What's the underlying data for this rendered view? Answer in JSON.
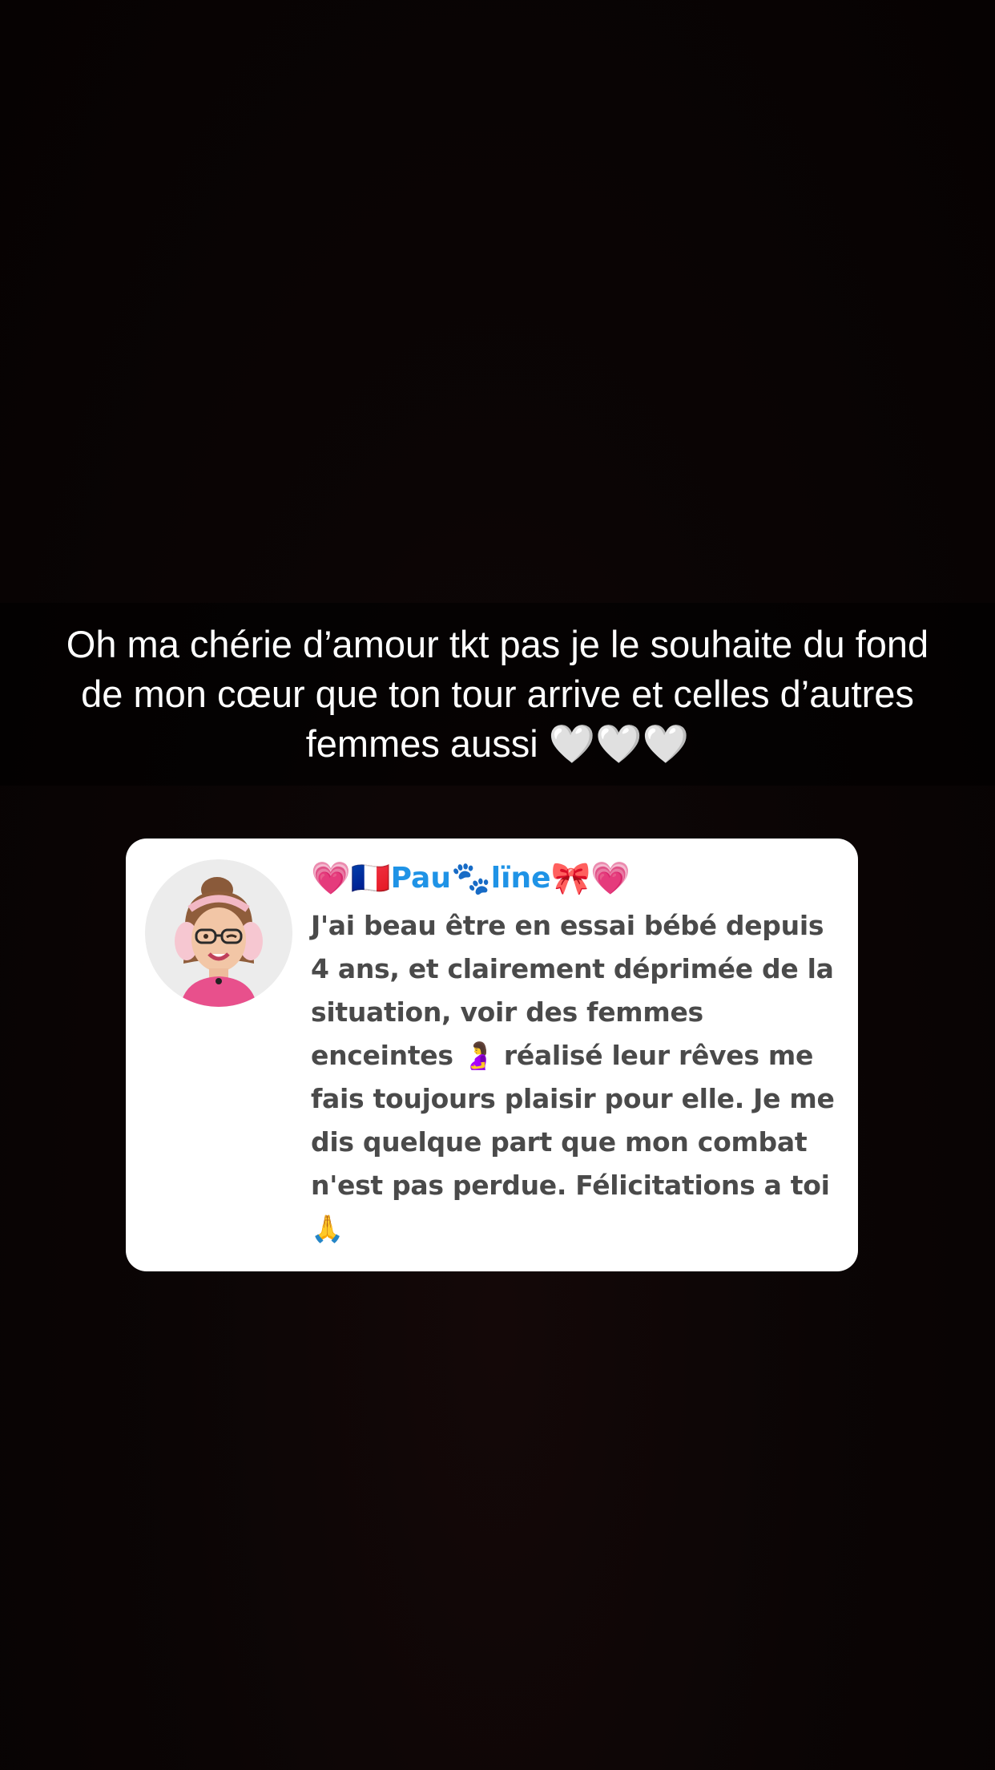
{
  "story": {
    "caption": "Oh ma chérie d’amour tkt pas je le souhaite du fond de mon cœur que ton tour arrive et celles d’autres femmes aussi 🤍🤍🤍"
  },
  "comment": {
    "avatar_icon": "bitmoji-avatar-icon",
    "username_prefix": "💗🇫🇷",
    "username_name_start": "Pau",
    "username_symbol": "🐾",
    "username_name_end": "lïne",
    "username_suffix": "🎀💗",
    "text": "J'ai beau être en essai bébé depuis 4 ans, et clairement déprimée de la situation, voir des femmes enceintes 🤰 réalisé leur rêves me fais toujours plaisir pour elle. Je me dis quelque part que mon combat n'est pas perdue. Félicitations a toi 🙏"
  },
  "colors": {
    "background": "#090303",
    "card": "#ffffff",
    "username": "#1f93e6",
    "comment_text": "#4a4a4a"
  }
}
